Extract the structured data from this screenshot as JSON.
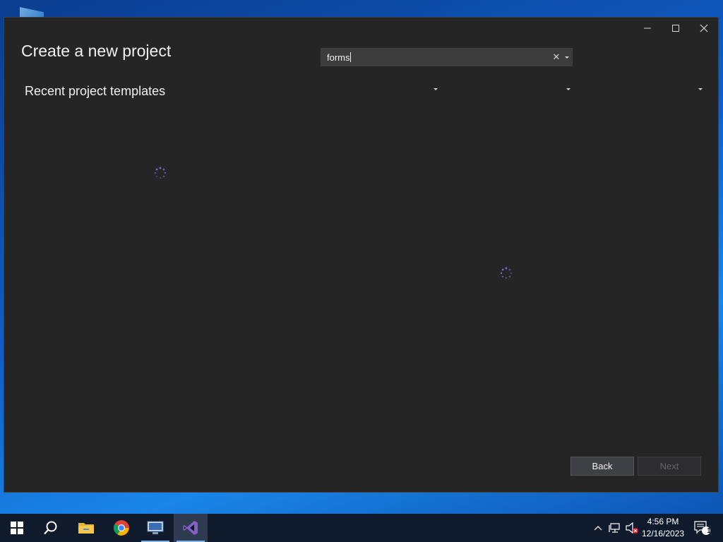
{
  "window": {
    "title": "Create a new project",
    "section_heading": "Recent project templates",
    "search": {
      "value": "forms"
    },
    "filters": [
      "",
      "",
      ""
    ],
    "buttons": {
      "back": "Back",
      "next": "Next"
    }
  },
  "taskbar": {
    "apps": [
      "start-icon",
      "search-icon",
      "file-explorer-icon",
      "chrome-icon",
      "remote-desktop-icon",
      "visual-studio-icon"
    ],
    "clock": {
      "time": "4:56 PM",
      "date": "12/16/2023"
    },
    "notification_count": "1"
  },
  "colors": {
    "window_bg": "#252526",
    "spinner": "#7c6fd6",
    "vs_purple": "#8661c5"
  }
}
